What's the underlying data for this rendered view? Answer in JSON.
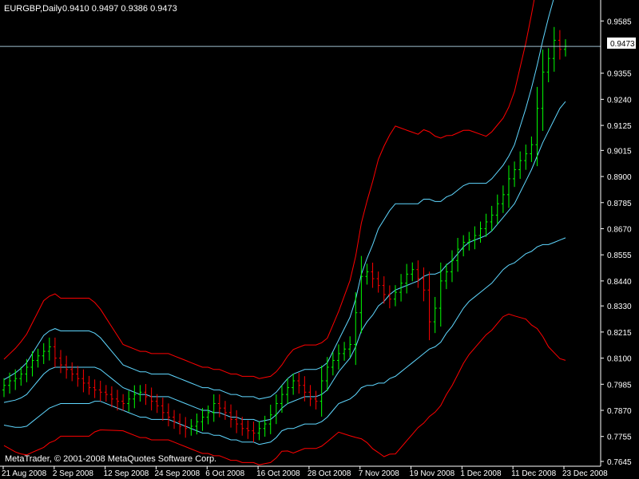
{
  "header": {
    "symbol_timeframe": "EURGBP,Daily",
    "ohlc": "0.9410 0.9497 0.9386 0.9473"
  },
  "footer": {
    "copyright": "MetaTrader, © 2001-2008 MetaQuotes Software Corp."
  },
  "price_label": "0.9473",
  "colors": {
    "background": "#000000",
    "up_bar": "#00ff00",
    "down_bar": "#ff0000",
    "bb20": "#5fd7ff",
    "bb20_outer": "#ff0000",
    "bid_line": "#a0c0d0",
    "axis": "#ffffff"
  },
  "chart_data": {
    "type": "ohlc",
    "title": "EURGBP,Daily",
    "ylim": [
      0.7645,
      0.96
    ],
    "y_ticks": [
      "0.9585",
      "0.9473",
      "0.9355",
      "0.9240",
      "0.9125",
      "0.9015",
      "0.8900",
      "0.8785",
      "0.8670",
      "0.8555",
      "0.8440",
      "0.8330",
      "0.8215",
      "0.8100",
      "0.7985",
      "0.7870",
      "0.7755",
      "0.7645"
    ],
    "x_ticks": [
      "21 Aug 2008",
      "2 Sep 2008",
      "12 Sep 2008",
      "24 Sep 2008",
      "6 Oct 2008",
      "16 Oct 2008",
      "28 Oct 2008",
      "7 Nov 2008",
      "19 Nov 2008",
      "1 Dec 2008",
      "11 Dec 2008",
      "23 Dec 2008"
    ],
    "last_price": 0.9473,
    "bars_close": [
      0.798,
      0.8,
      0.801,
      0.803,
      0.806,
      0.809,
      0.811,
      0.813,
      0.815,
      0.81,
      0.807,
      0.805,
      0.803,
      0.801,
      0.799,
      0.797,
      0.796,
      0.795,
      0.794,
      0.792,
      0.791,
      0.79,
      0.792,
      0.794,
      0.795,
      0.793,
      0.791,
      0.789,
      0.786,
      0.784,
      0.782,
      0.78,
      0.779,
      0.78,
      0.782,
      0.784,
      0.786,
      0.79,
      0.788,
      0.786,
      0.783,
      0.781,
      0.779,
      0.778,
      0.777,
      0.779,
      0.781,
      0.785,
      0.79,
      0.794,
      0.797,
      0.8,
      0.798,
      0.795,
      0.792,
      0.791,
      0.8,
      0.806,
      0.809,
      0.812,
      0.814,
      0.816,
      0.83,
      0.846,
      0.848,
      0.845,
      0.842,
      0.838,
      0.836,
      0.839,
      0.843,
      0.847,
      0.849,
      0.845,
      0.84,
      0.826,
      0.832,
      0.844,
      0.848,
      0.853,
      0.858,
      0.861,
      0.862,
      0.864,
      0.867,
      0.87,
      0.873,
      0.878,
      0.882,
      0.889,
      0.893,
      0.897,
      0.9,
      0.904,
      0.92,
      0.936,
      0.942,
      0.95,
      0.946,
      0.9473
    ],
    "bands_mid": [
      0.7905,
      0.791,
      0.7915,
      0.7925,
      0.794,
      0.797,
      0.8,
      0.803,
      0.805,
      0.806,
      0.806,
      0.806,
      0.806,
      0.806,
      0.806,
      0.806,
      0.806,
      0.805,
      0.803,
      0.801,
      0.799,
      0.797,
      0.796,
      0.795,
      0.794,
      0.794,
      0.793,
      0.793,
      0.793,
      0.793,
      0.792,
      0.791,
      0.79,
      0.789,
      0.788,
      0.787,
      0.787,
      0.786,
      0.786,
      0.785,
      0.784,
      0.784,
      0.783,
      0.783,
      0.783,
      0.782,
      0.7825,
      0.783,
      0.785,
      0.788,
      0.79,
      0.791,
      0.792,
      0.793,
      0.793,
      0.793,
      0.794,
      0.796,
      0.8,
      0.804,
      0.807,
      0.81,
      0.815,
      0.822,
      0.826,
      0.829,
      0.833,
      0.835,
      0.838,
      0.84,
      0.841,
      0.842,
      0.843,
      0.844,
      0.846,
      0.847,
      0.847,
      0.848,
      0.851,
      0.853,
      0.856,
      0.859,
      0.861,
      0.862,
      0.863,
      0.864,
      0.866,
      0.869,
      0.872,
      0.875,
      0.878,
      0.883,
      0.888,
      0.893,
      0.899,
      0.905,
      0.91,
      0.915,
      0.92,
      0.923
    ],
    "bands_width": [
      0.01,
      0.011,
      0.012,
      0.013,
      0.014,
      0.015,
      0.016,
      0.017,
      0.017,
      0.017,
      0.016,
      0.016,
      0.016,
      0.016,
      0.016,
      0.016,
      0.015,
      0.014,
      0.013,
      0.012,
      0.011,
      0.01,
      0.01,
      0.01,
      0.01,
      0.01,
      0.01,
      0.01,
      0.01,
      0.01,
      0.01,
      0.01,
      0.01,
      0.01,
      0.01,
      0.01,
      0.01,
      0.01,
      0.01,
      0.01,
      0.01,
      0.01,
      0.01,
      0.01,
      0.01,
      0.01,
      0.01,
      0.01,
      0.01,
      0.01,
      0.011,
      0.012,
      0.012,
      0.012,
      0.012,
      0.012,
      0.012,
      0.012,
      0.013,
      0.014,
      0.016,
      0.018,
      0.021,
      0.025,
      0.028,
      0.031,
      0.034,
      0.036,
      0.037,
      0.038,
      0.037,
      0.036,
      0.035,
      0.034,
      0.034,
      0.033,
      0.032,
      0.031,
      0.03,
      0.029,
      0.028,
      0.027,
      0.026,
      0.025,
      0.024,
      0.023,
      0.023,
      0.023,
      0.023,
      0.024,
      0.026,
      0.029,
      0.032,
      0.036,
      0.04,
      0.045,
      0.05,
      0.054,
      0.058,
      0.06
    ]
  }
}
